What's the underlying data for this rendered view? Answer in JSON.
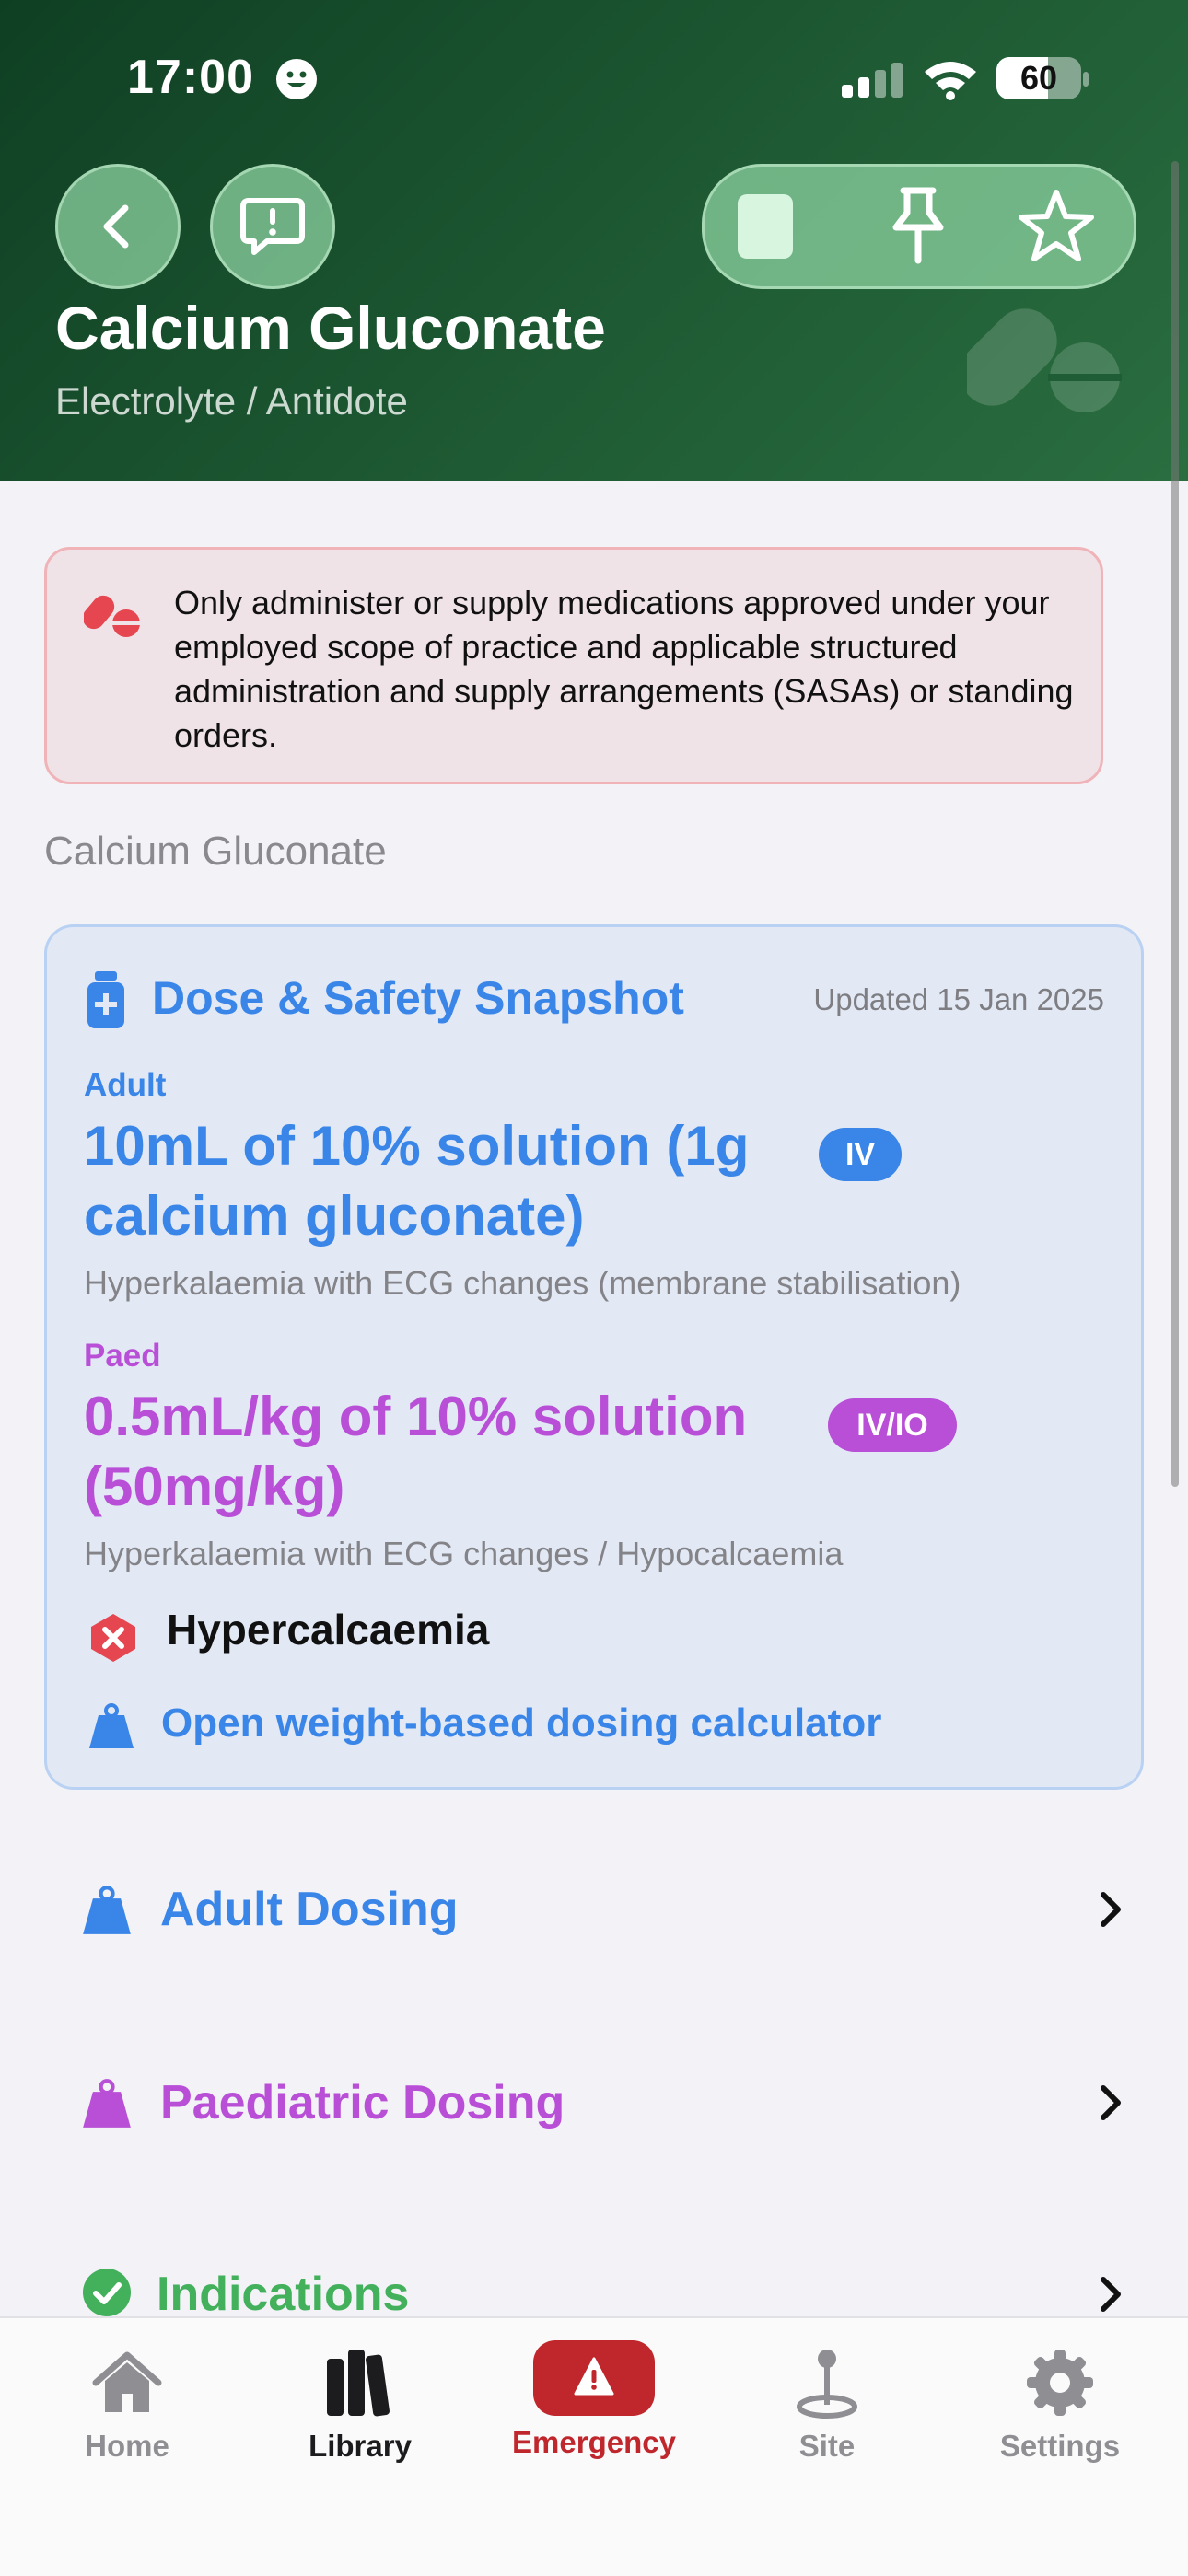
{
  "status_bar": {
    "time": "17:00",
    "battery": "60"
  },
  "header": {
    "title": "Calcium Gluconate",
    "subtitle": "Electrolyte / Antidote",
    "colors": {
      "bg_dark": "#0f3f23",
      "bg_light": "#2a6e40"
    }
  },
  "warning": {
    "text": "Only administer or supply medications approved under your employed scope of practice and applicable structured administration and supply arrangements (SASAs) or standing orders."
  },
  "section_label": "Calcium Gluconate",
  "snapshot": {
    "title": "Dose & Safety Snapshot",
    "updated": "Updated 15 Jan 2025",
    "adult": {
      "label": "Adult",
      "dose": "10mL of 10% solution (1g calcium gluconate)",
      "route": "IV",
      "indication": "Hyperkalaemia with ECG changes (membrane stabilisation)"
    },
    "paed": {
      "label": "Paed",
      "dose": "0.5mL/kg of 10% solution (50mg/kg)",
      "route": "IV/IO",
      "indication": "Hyperkalaemia with ECG changes / Hypocalcaemia"
    },
    "contraindication": "Hypercalcaemia",
    "calculator_link": "Open weight-based dosing calculator"
  },
  "rows": [
    {
      "label": "Adult Dosing",
      "color": "#3a85e8"
    },
    {
      "label": "Paediatric Dosing",
      "color": "#b84fd6"
    },
    {
      "label": "Indications",
      "color": "#43b05c"
    }
  ],
  "tabs": [
    {
      "label": "Home",
      "icon": "house-icon"
    },
    {
      "label": "Library",
      "icon": "books-icon",
      "active": true
    },
    {
      "label": "Emergency",
      "icon": "warning-icon"
    },
    {
      "label": "Site",
      "icon": "map-pin-icon"
    },
    {
      "label": "Settings",
      "icon": "gear-icon"
    }
  ],
  "colors": {
    "accent_blue": "#3a85e8",
    "accent_purple": "#b84fd6",
    "accent_green": "#43b05c",
    "emergency_red": "#c0272d"
  }
}
